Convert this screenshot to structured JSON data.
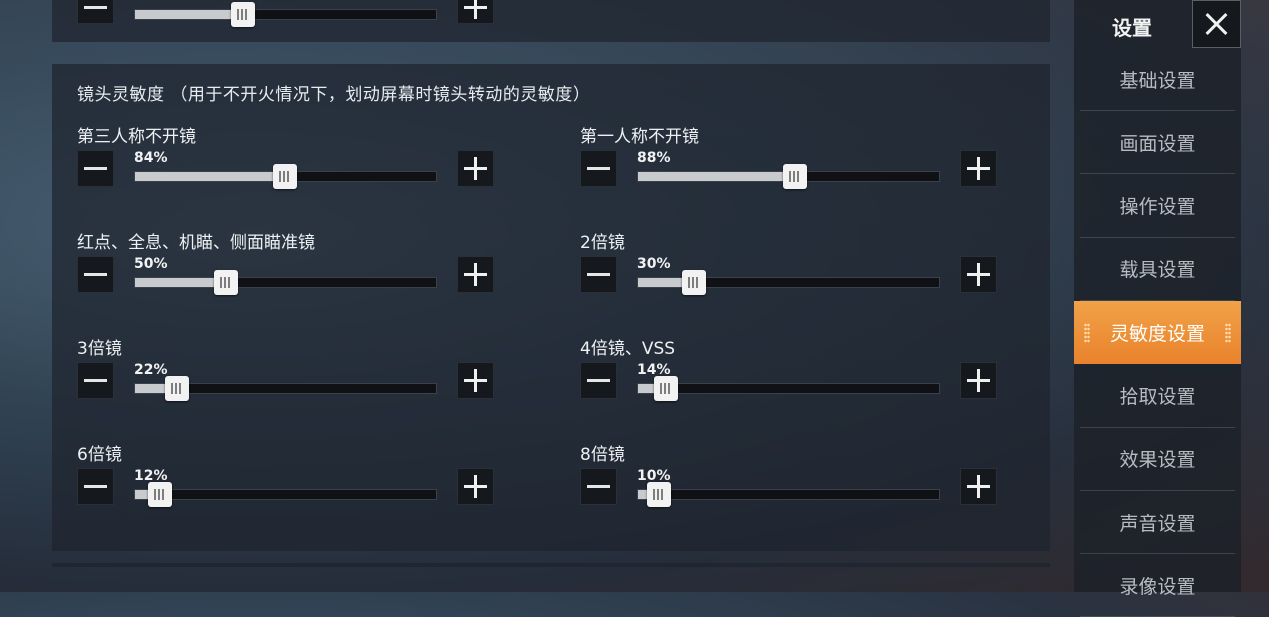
{
  "top_slider": {
    "value": 36
  },
  "section": {
    "title": "镜头灵敏度 （用于不开火情况下，划动屏幕时镜头转动的灵敏度）"
  },
  "settings": [
    {
      "label": "第三人称不开镜",
      "value_label": "84%",
      "value": 84
    },
    {
      "label": "第一人称不开镜",
      "value_label": "88%",
      "value": 88
    },
    {
      "label": "红点、全息、机瞄、侧面瞄准镜",
      "value_label": "50%",
      "value": 50
    },
    {
      "label": "2倍镜",
      "value_label": "30%",
      "value": 30
    },
    {
      "label": "3倍镜",
      "value_label": "22%",
      "value": 22
    },
    {
      "label": "4倍镜、VSS",
      "value_label": "14%",
      "value": 14
    },
    {
      "label": "6倍镜",
      "value_label": "12%",
      "value": 12
    },
    {
      "label": "8倍镜",
      "value_label": "10%",
      "value": 10
    }
  ],
  "icons": {
    "minus": "minus-icon",
    "plus": "plus-icon",
    "close": "close-icon"
  },
  "sidebar": {
    "title": "设置",
    "items": [
      {
        "label": "基础设置"
      },
      {
        "label": "画面设置"
      },
      {
        "label": "操作设置"
      },
      {
        "label": "载具设置"
      },
      {
        "label": "灵敏度设置",
        "active": true
      },
      {
        "label": "拾取设置"
      },
      {
        "label": "效果设置"
      },
      {
        "label": "声音设置"
      },
      {
        "label": "录像设置"
      }
    ]
  },
  "colors": {
    "accent": "#ec8a33",
    "panel": "#1e242e",
    "track": "#0f1114"
  }
}
